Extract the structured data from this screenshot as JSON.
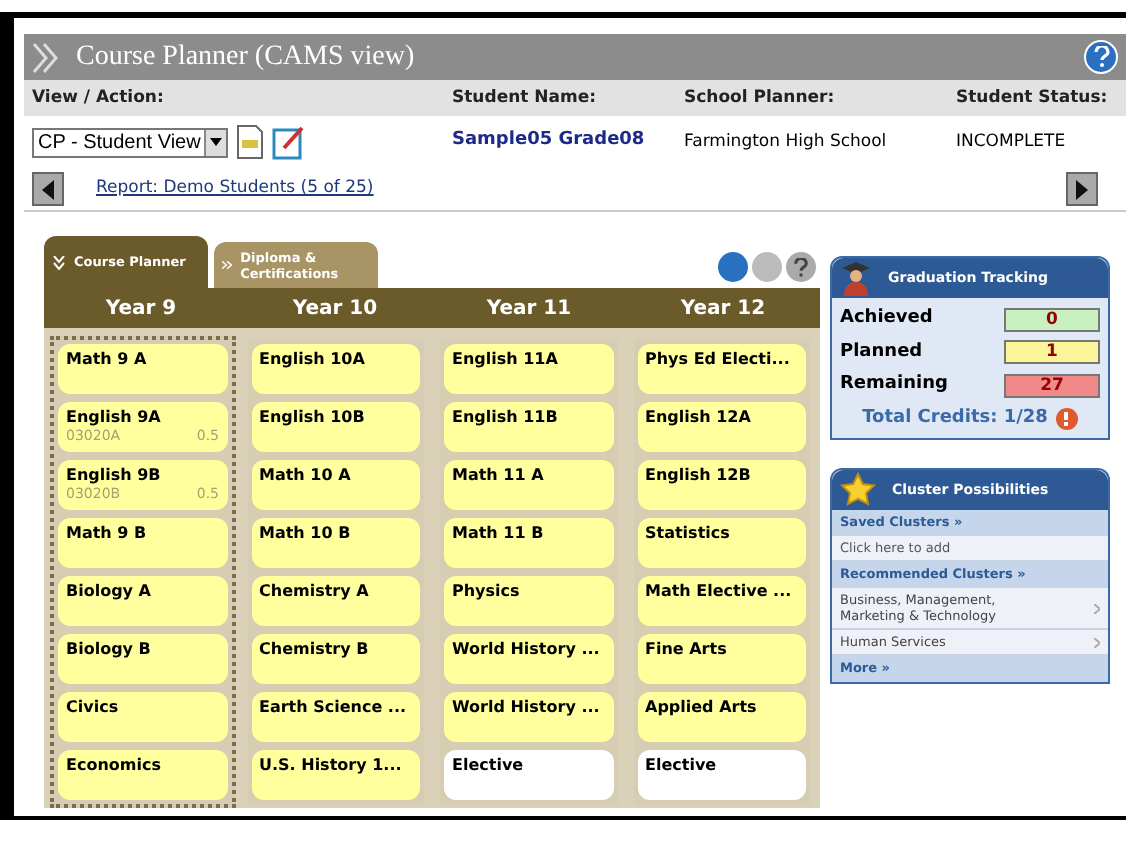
{
  "window": {
    "title": "Course Planner (CAMS view)"
  },
  "header": {
    "labels": [
      "View / Action:",
      "Student Name:",
      "School Planner:",
      "Student Status:"
    ],
    "view_select": "CP - Student View",
    "student_name": "Sample05 Grade08",
    "school": "Farmington High School",
    "status": "INCOMPLETE",
    "report_link": "Report: Demo Students (5 of 25)"
  },
  "tabs": [
    {
      "label": "Course Planner",
      "selected": true
    },
    {
      "label": "Diploma & Certifications",
      "selected": false
    }
  ],
  "years": [
    {
      "label": "Year 9",
      "selected": true,
      "courses": [
        {
          "name": "Math 9 A",
          "kind": "course"
        },
        {
          "name": "English 9A",
          "code": "03020A",
          "credits": "0.5",
          "kind": "course"
        },
        {
          "name": "English 9B",
          "code": "03020B",
          "credits": "0.5",
          "kind": "course"
        },
        {
          "name": "Math 9 B",
          "kind": "course"
        },
        {
          "name": "Biology A",
          "kind": "course"
        },
        {
          "name": "Biology B",
          "kind": "course"
        },
        {
          "name": "Civics",
          "kind": "course"
        },
        {
          "name": "Economics",
          "kind": "course"
        }
      ]
    },
    {
      "label": "Year 10",
      "selected": false,
      "courses": [
        {
          "name": "English 10A",
          "kind": "course"
        },
        {
          "name": "English 10B",
          "kind": "course"
        },
        {
          "name": "Math 10 A",
          "kind": "course"
        },
        {
          "name": "Math 10 B",
          "kind": "course"
        },
        {
          "name": "Chemistry A",
          "kind": "course"
        },
        {
          "name": "Chemistry B",
          "kind": "course"
        },
        {
          "name": "Earth Science ...",
          "kind": "course"
        },
        {
          "name": "U.S. History 1...",
          "kind": "course"
        }
      ]
    },
    {
      "label": "Year 11",
      "selected": false,
      "courses": [
        {
          "name": "English 11A",
          "kind": "course"
        },
        {
          "name": "English 11B",
          "kind": "course"
        },
        {
          "name": "Math 11 A",
          "kind": "course"
        },
        {
          "name": "Math 11 B",
          "kind": "course"
        },
        {
          "name": "Physics",
          "kind": "course"
        },
        {
          "name": "World History ...",
          "kind": "course"
        },
        {
          "name": "World History ...",
          "kind": "course"
        },
        {
          "name": "Elective",
          "kind": "elective"
        }
      ]
    },
    {
      "label": "Year 12",
      "selected": false,
      "courses": [
        {
          "name": "Phys Ed Electi...",
          "kind": "course"
        },
        {
          "name": "English 12A",
          "kind": "course"
        },
        {
          "name": "English 12B",
          "kind": "course"
        },
        {
          "name": "Statistics",
          "kind": "course"
        },
        {
          "name": "Math Elective ...",
          "kind": "course"
        },
        {
          "name": "Fine Arts",
          "kind": "course"
        },
        {
          "name": "Applied Arts",
          "kind": "course"
        },
        {
          "name": "Elective",
          "kind": "elective"
        }
      ]
    }
  ],
  "graduation": {
    "title": "Graduation Tracking",
    "rows": [
      {
        "label": "Achieved",
        "value": "0",
        "color": "#c8f0c0"
      },
      {
        "label": "Planned",
        "value": "1",
        "color": "#fbf59a"
      },
      {
        "label": "Remaining",
        "value": "27",
        "color": "#f08a8a"
      }
    ],
    "total": "Total Credits: 1/28"
  },
  "clusters": {
    "title": "Cluster Possibilities",
    "items": [
      {
        "label": "Saved Clusters »",
        "kind": "heading"
      },
      {
        "label": "Click here to add",
        "kind": "action"
      },
      {
        "label": "Recommended Clusters »",
        "kind": "heading"
      },
      {
        "label": "Business, Management, Marketing & Technology",
        "kind": "link"
      },
      {
        "label": "Human Services",
        "kind": "link"
      },
      {
        "label": "More »",
        "kind": "heading"
      }
    ]
  }
}
